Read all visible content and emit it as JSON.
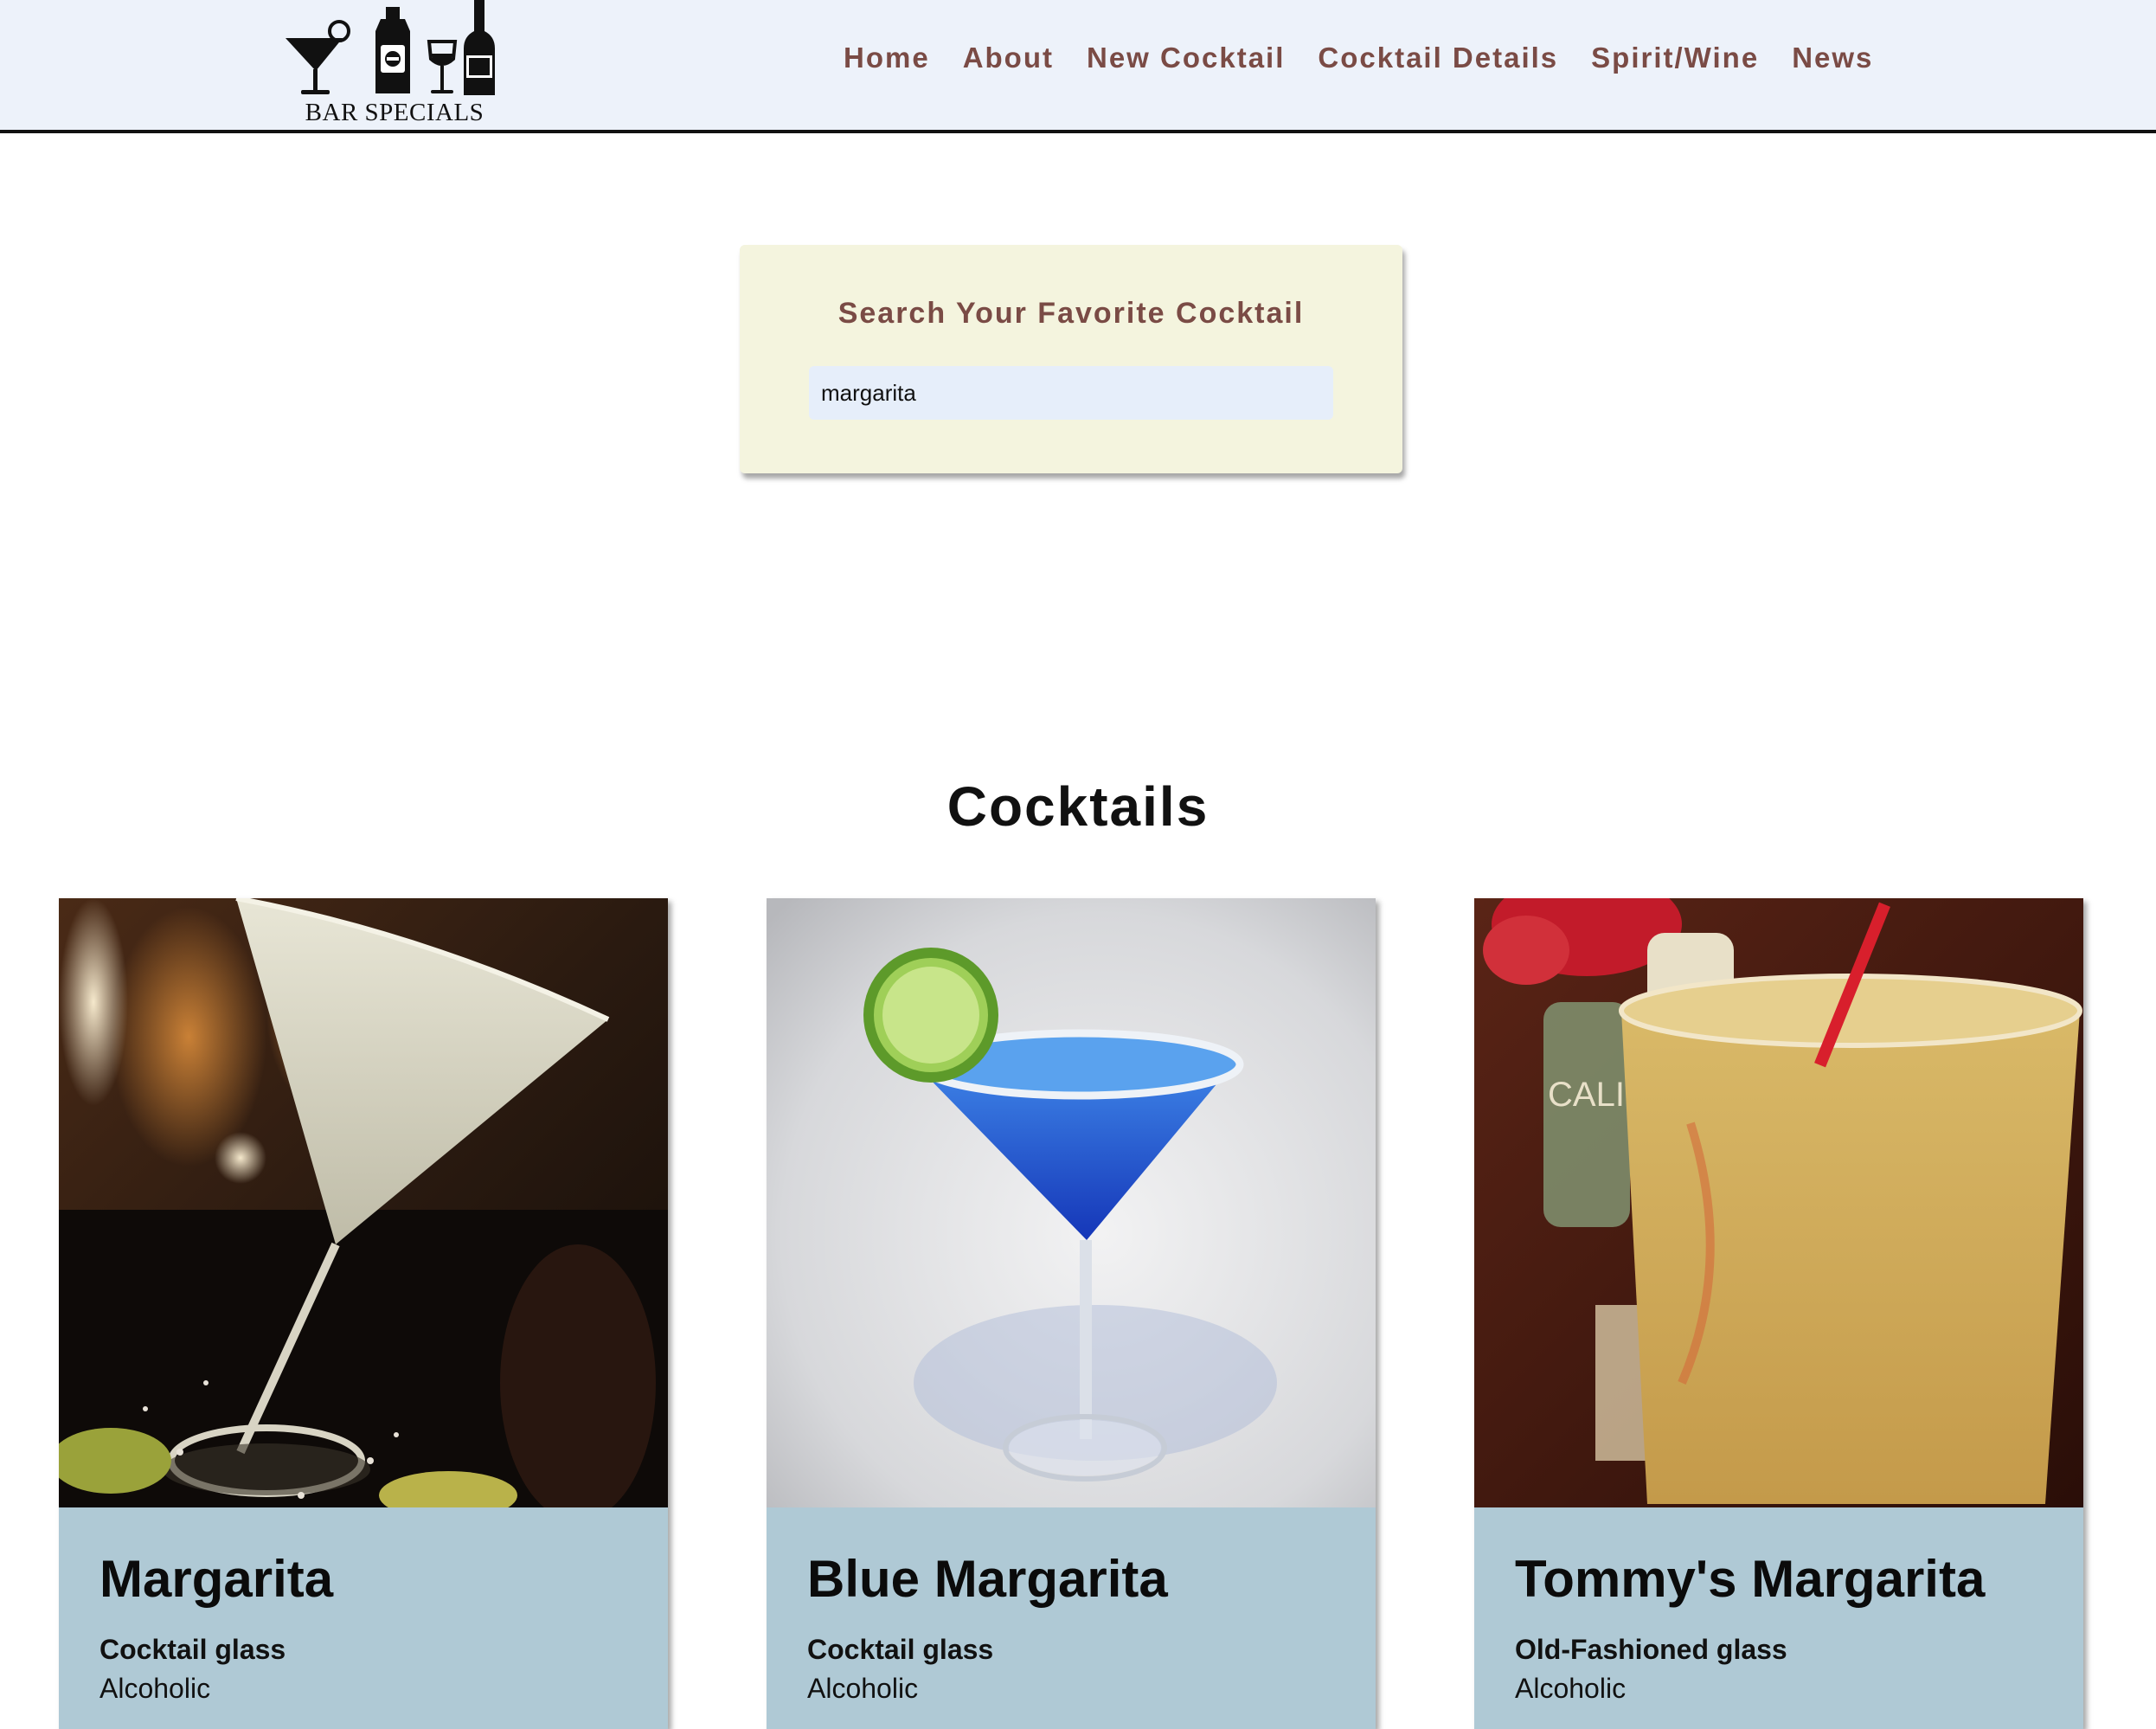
{
  "brand": {
    "logo_text": "BAR SPECIALS"
  },
  "nav": {
    "items": [
      {
        "label": "Home"
      },
      {
        "label": "About"
      },
      {
        "label": "New Cocktail"
      },
      {
        "label": "Cocktail Details"
      },
      {
        "label": "Spirit/Wine"
      },
      {
        "label": "News"
      }
    ]
  },
  "search": {
    "title": "Search Your Favorite Cocktail",
    "value": "margarita"
  },
  "cocktails": {
    "heading": "Cocktails",
    "items": [
      {
        "name": "Margarita",
        "glass": "Cocktail glass",
        "type": "Alcoholic"
      },
      {
        "name": "Blue Margarita",
        "glass": "Cocktail glass",
        "type": "Alcoholic"
      },
      {
        "name": "Tommy's Margarita",
        "glass": "Old-Fashioned glass",
        "type": "Alcoholic"
      }
    ]
  },
  "colors": {
    "navbar_bg": "#edf2fa",
    "nav_text": "#7a4b45",
    "search_card_bg": "#f4f4de",
    "search_input_bg": "#e6eefa",
    "card_bg": "#afc9d5"
  }
}
